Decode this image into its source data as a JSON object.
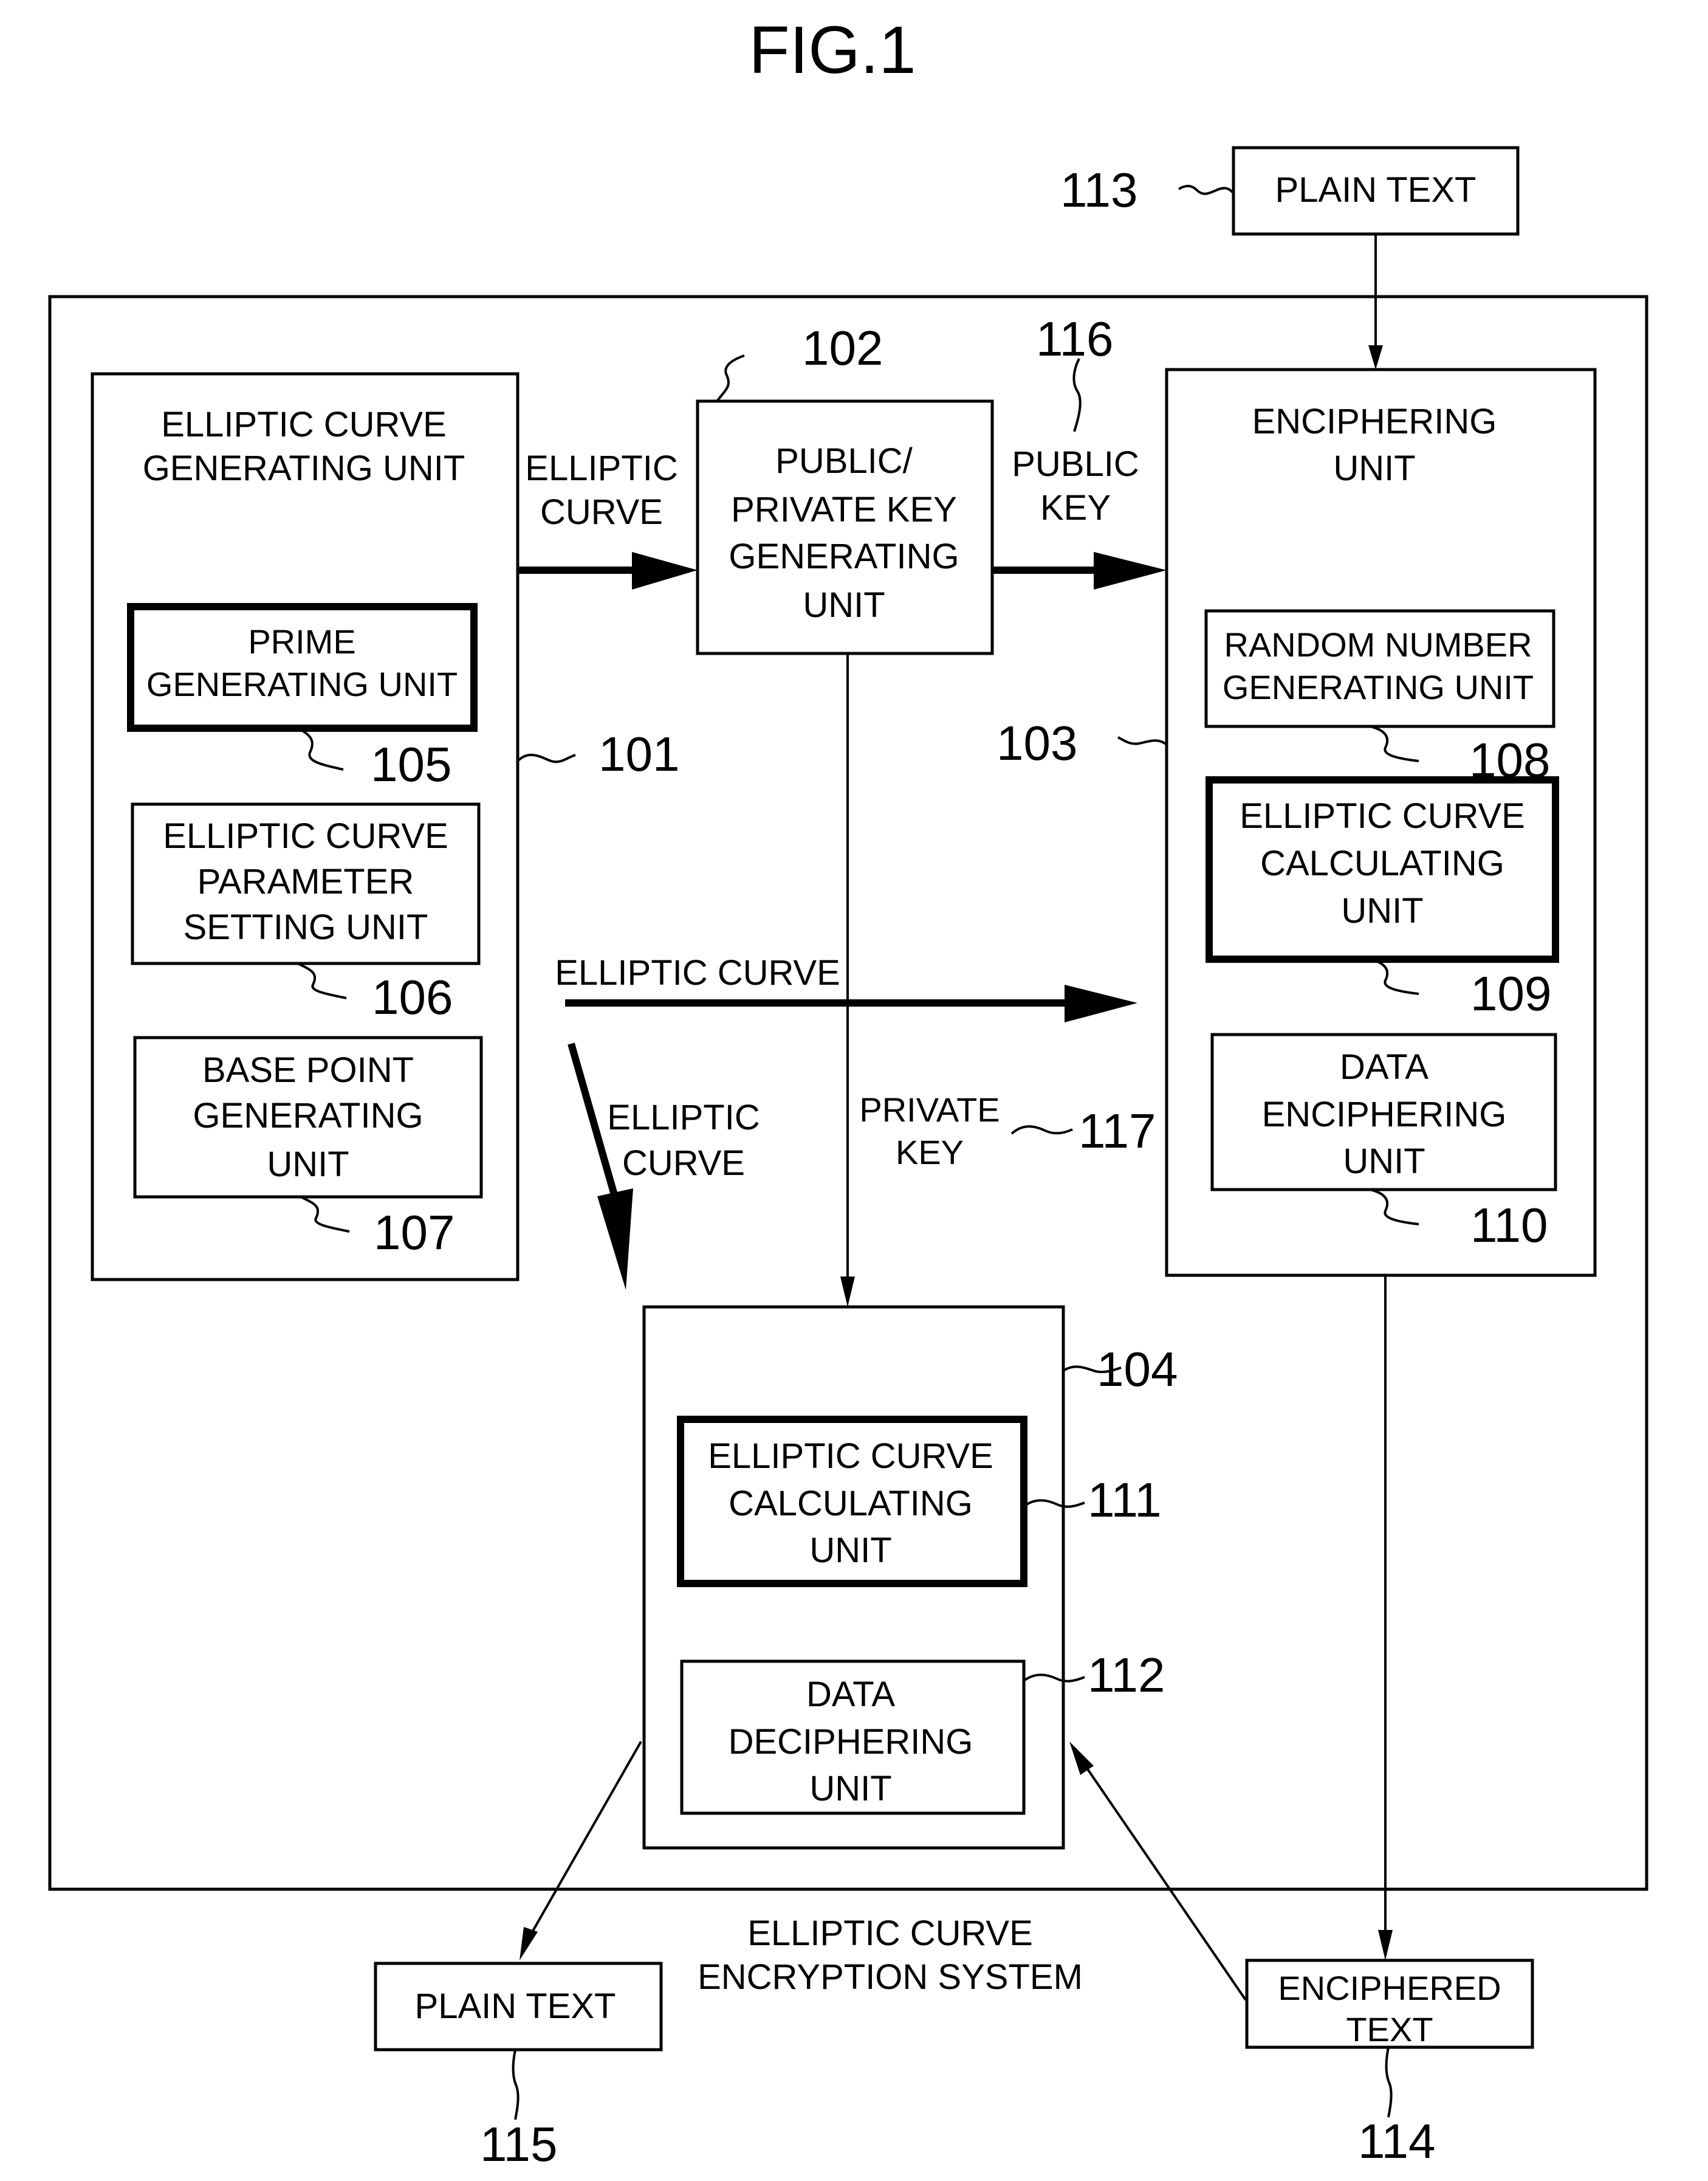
{
  "figure": {
    "title": "FIG.1",
    "system_label": [
      "ELLIPTIC CURVE",
      "ENCRYPTION SYSTEM"
    ]
  },
  "blocks": {
    "plain_text_in": {
      "ref": "113",
      "lines": [
        "PLAIN TEXT"
      ]
    },
    "ec_generating_unit": {
      "ref": "101",
      "lines": [
        "ELLIPTIC CURVE",
        "GENERATING UNIT"
      ]
    },
    "prime_generating_unit": {
      "ref": "105",
      "lines": [
        "PRIME",
        "GENERATING UNIT"
      ]
    },
    "ec_parameter_setting_unit": {
      "ref": "106",
      "lines": [
        "ELLIPTIC CURVE",
        "PARAMETER",
        "SETTING UNIT"
      ]
    },
    "base_point_generating_unit": {
      "ref": "107",
      "lines": [
        "BASE POINT",
        "GENERATING",
        "UNIT"
      ]
    },
    "key_generating_unit": {
      "ref": "102",
      "lines": [
        "PUBLIC/",
        "PRIVATE KEY",
        "GENERATING",
        "UNIT"
      ]
    },
    "enciphering_unit": {
      "ref": "103",
      "lines": [
        "ENCIPHERING",
        "UNIT"
      ]
    },
    "random_number_generating_unit": {
      "ref": "108",
      "lines": [
        "RANDOM NUMBER",
        "GENERATING UNIT"
      ]
    },
    "ec_calculating_unit_enc": {
      "ref": "109",
      "lines": [
        "ELLIPTIC CURVE",
        "CALCULATING",
        "UNIT"
      ]
    },
    "data_enciphering_unit": {
      "ref": "110",
      "lines": [
        "DATA",
        "ENCIPHERING",
        "UNIT"
      ]
    },
    "deciphering_unit": {
      "ref": "104"
    },
    "ec_calculating_unit_dec": {
      "ref": "111",
      "lines": [
        "ELLIPTIC CURVE",
        "CALCULATING",
        "UNIT"
      ]
    },
    "data_deciphering_unit": {
      "ref": "112",
      "lines": [
        "DATA",
        "DECIPHERING",
        "UNIT"
      ]
    },
    "plain_text_out": {
      "ref": "115",
      "lines": [
        "PLAIN TEXT"
      ]
    },
    "enciphered_text": {
      "ref": "114",
      "lines": [
        "ENCIPHERED",
        "TEXT"
      ]
    }
  },
  "arrows": {
    "ec_to_keygen": [
      "ELLIPTIC",
      "CURVE"
    ],
    "public_key": {
      "ref": "116",
      "lines": [
        "PUBLIC",
        "KEY"
      ]
    },
    "ec_to_enciphering": [
      "ELLIPTIC CURVE"
    ],
    "ec_to_deciphering": [
      "ELLIPTIC",
      "CURVE"
    ],
    "private_key": {
      "ref": "117",
      "lines": [
        "PRIVATE",
        "KEY"
      ]
    }
  }
}
